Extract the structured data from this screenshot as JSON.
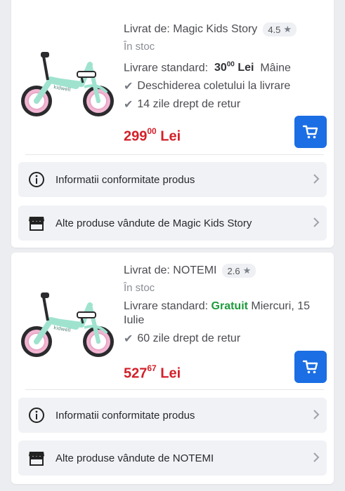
{
  "colors": {
    "accent": "#1b6ee3",
    "price": "#d32029",
    "free": "#1e9b3c",
    "background": "#ecedf1"
  },
  "icons": {
    "cart": "cart-icon",
    "info": "info-circle-icon",
    "store": "store-icon",
    "chevron": "chevron-right-icon",
    "check": "check-icon",
    "star": "star-icon"
  },
  "offers": [
    {
      "seller_prefix": "Livrat de:",
      "seller_name": "Magic Kids Story",
      "rating": "4.5",
      "stock": "În stoc",
      "delivery_label": "Livrare standard:",
      "delivery_price_int": "30",
      "delivery_price_dec": "00",
      "delivery_currency": "Lei",
      "delivery_day": "Mâine",
      "features": [
        "Deschiderea coletului la livrare",
        "14 zile drept de retur"
      ],
      "price_int": "299",
      "price_dec": "00",
      "currency": "Lei",
      "compliance_label": "Informatii conformitate produs",
      "other_products_label": "Alte produse vândute de Magic Kids Story"
    },
    {
      "seller_prefix": "Livrat de:",
      "seller_name": "NOTEMI",
      "rating": "2.6",
      "stock": "În stoc",
      "delivery_label": "Livrare standard:",
      "delivery_free": "Gratuit",
      "delivery_day": "Miercuri, 15 Iulie",
      "features": [
        "60 zile drept de retur"
      ],
      "price_int": "527",
      "price_dec": "67",
      "currency": "Lei",
      "compliance_label": "Informatii conformitate produs",
      "other_products_label": "Alte produse vândute de NOTEMI"
    }
  ]
}
